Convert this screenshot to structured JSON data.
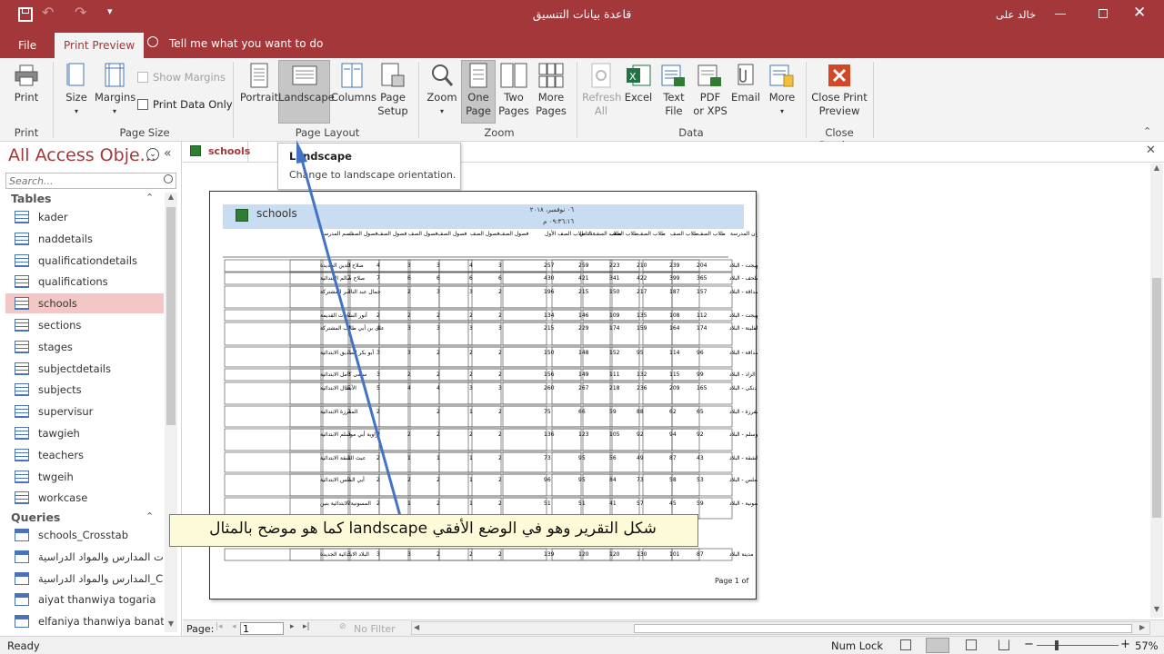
{
  "window": {
    "title": "قاعدة بيانات التنسيق",
    "user": "خالد على"
  },
  "tabs": {
    "file": "File",
    "print_preview": "Print Preview",
    "tell_me": "Tell me what you want to do"
  },
  "ribbon": {
    "print": "Print",
    "size": "Size",
    "margins": "Margins",
    "show_margins": "Show Margins",
    "print_data_only": "Print Data Only",
    "portrait": "Portrait",
    "landscape": "Landscape",
    "columns": "Columns",
    "page_setup_1": "Page",
    "page_setup_2": "Setup",
    "zoom": "Zoom",
    "one_page_1": "One",
    "one_page_2": "Page",
    "two_pages_1": "Two",
    "two_pages_2": "Pages",
    "more_pages_1": "More",
    "more_pages_2": "Pages",
    "refresh_all_1": "Refresh",
    "refresh_all_2": "All",
    "excel": "Excel",
    "text_file_1": "Text",
    "text_file_2": "File",
    "pdf_1": "PDF",
    "pdf_2": "or XPS",
    "email": "Email",
    "more": "More",
    "close_1": "Close Print",
    "close_2": "Preview",
    "groups": {
      "print": "Print",
      "page_size": "Page Size",
      "page_layout": "Page Layout",
      "zoom": "Zoom",
      "data": "Data",
      "close_preview": "Close Preview"
    }
  },
  "tooltip": {
    "title": "Landscape",
    "body": "Change to landscape orientation."
  },
  "nav": {
    "title": "All Access Obje...",
    "search_placeholder": "Search...",
    "tables_header": "Tables",
    "tables": [
      "kader",
      "naddetails",
      "qualificationdetails",
      "qualifications",
      "schools",
      "sections",
      "stages",
      "subjectdetails",
      "subjects",
      "supervisur",
      "tawgieh",
      "teachers",
      "twgeih",
      "workcase"
    ],
    "queries_header": "Queries",
    "queries": [
      "schools_Crosstab",
      "احصائيات المدارس والمواد الدراسية",
      "المدارس والمواد الدراسية_Crosst...",
      "aiyat thanwiya togaria",
      "elfaniya thanwiya banat"
    ]
  },
  "doc": {
    "tab": "schools",
    "report_title": "schools",
    "report_date": "٠٦ نوفمبر، ٢٠١٨",
    "report_time": "٠٩:٣٦:١٦ م",
    "page_footer": "Page 1 of",
    "columns": [
      "عنوان المدرسة",
      "طلاب الصف",
      "طلاب الصف",
      "طلاب الصف",
      "طلاب الصف",
      "طلاب الصف الثاني",
      "عدد طلاب الصف الأول",
      "فصول الصف",
      "فصول الصف",
      "فصول الصف",
      "فصول الصف",
      "فصول الصف",
      "فصول الصف",
      "اسم المدرسة"
    ],
    "rows": [
      [
        "قرية بهيجت - البلاد",
        "204",
        "239",
        "210",
        "223",
        "259",
        "257",
        "3",
        "4",
        "3",
        "3",
        "4",
        "3",
        "صلاح الدين الجديدة"
      ],
      [
        "قرية الشلحف - البلاد",
        "365",
        "399",
        "422",
        "341",
        "421",
        "430",
        "6",
        "6",
        "6",
        "6",
        "7",
        "7",
        "صلاح سالم الابتدائية"
      ],
      [
        "قرية الصداقة - البلاد",
        "157",
        "187",
        "217",
        "150",
        "215",
        "196",
        "2",
        "3",
        "3",
        "2",
        "",
        "3",
        "جمال عبد الناصر المشتركة"
      ],
      [
        "قرية بهيجت - البلاد",
        "112",
        "108",
        "135",
        "109",
        "146",
        "134",
        "2",
        "2",
        "2",
        "2",
        "2",
        "2",
        "أنور السادات القديمة"
      ],
      [
        "قرية الفلينة - البلاد",
        "174",
        "164",
        "159",
        "174",
        "229",
        "215",
        "3",
        "3",
        "3",
        "3",
        "4",
        "4",
        "على بن أبي طالب المشتركة"
      ],
      [
        "قرية الصداقة - البلاد",
        "96",
        "114",
        "95",
        "152",
        "148",
        "150",
        "2",
        "2",
        "2",
        "3",
        "3",
        "3",
        "أبو بكر الصديق الابتدائية"
      ],
      [
        "قرية الزاد - البلاد",
        "99",
        "115",
        "132",
        "111",
        "149",
        "156",
        "2",
        "2",
        "2",
        "2",
        "3",
        "3",
        "سامى كامل الابتدائية"
      ],
      [
        "قرية كفر دنكى - البلاد",
        "165",
        "209",
        "236",
        "218",
        "267",
        "260",
        "3",
        "3",
        "4",
        "4",
        "5",
        "5",
        "الأبطال الابتدائية"
      ],
      [
        "قرية المفرزة - البلاد",
        "65",
        "62",
        "88",
        "59",
        "66",
        "75",
        "2",
        "1",
        "2",
        "",
        "2",
        "2",
        "المفرزة الابتدائية"
      ],
      [
        "قرية زاوية أبو موسلم - البلاد",
        "92",
        "94",
        "92",
        "105",
        "123",
        "136",
        "2",
        "2",
        "2",
        "2",
        "2",
        "3",
        "زاوية أبي موسلم الابتدائية"
      ],
      [
        "قرية عبث الشقة - البلاد",
        "43",
        "87",
        "49",
        "56",
        "95",
        "73",
        "2",
        "1",
        "1",
        "1",
        "2",
        "1",
        "عبث الشقة الابتدائية"
      ],
      [
        "قرية أبي الملس - البلاد",
        "53",
        "58",
        "73",
        "84",
        "95",
        "96",
        "2",
        "1",
        "2",
        "2",
        "2",
        "2",
        "أبي الملس الابتدائية"
      ],
      [
        "قرية المسونية - البلاد",
        "59",
        "45",
        "57",
        "41",
        "51",
        "51",
        "2",
        "1",
        "2",
        "1",
        "2",
        "2",
        "المسونية الابتدائية بنين"
      ],
      [
        "مدينة البلاد",
        "87",
        "101",
        "130",
        "120",
        "120",
        "139",
        "2",
        "2",
        "2",
        "3",
        "3",
        "3",
        "البلاد الابتدائية الجديدة"
      ]
    ]
  },
  "annotation": {
    "text": "شكل التقرير وهو في الوضع الأفقي landscape كما هو موضح بالمثال"
  },
  "pager": {
    "label": "Page:",
    "value": "1",
    "no_filter": "No Filter"
  },
  "status": {
    "ready": "Ready",
    "num_lock": "Num Lock",
    "zoom": "57%"
  },
  "colors": {
    "accent": "#a4373a",
    "selected": "#f4c7c7",
    "arrow": "#4472c4",
    "annotation_bg": "#fdfbd7"
  }
}
